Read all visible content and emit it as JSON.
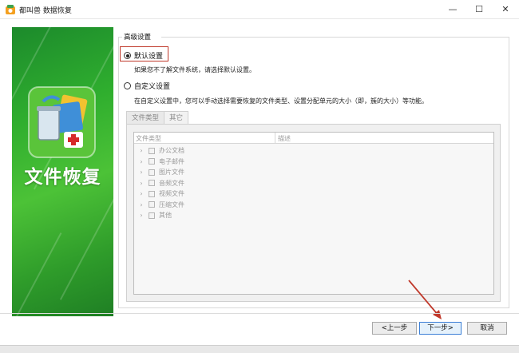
{
  "window": {
    "title": "都叫兽 数据恢复",
    "minimize_glyph": "—",
    "maximize_glyph": "☐",
    "close_glyph": "✕"
  },
  "sidebar": {
    "heading": "文件恢复",
    "icon": "recycle-bin-folder-rescue-icon"
  },
  "settings": {
    "group_label": "高级设置",
    "default_option": {
      "label": "默认设置",
      "selected": true,
      "hint": "如果您不了解文件系统，请选择默认设置。"
    },
    "custom_option": {
      "label": "自定义设置",
      "selected": false,
      "hint": "在自定义设置中，您可以手动选择需要恢复的文件类型、设置分配单元的大小（即，簇的大小）等功能。"
    }
  },
  "tabs": [
    {
      "label": "文件类型",
      "active": true
    },
    {
      "label": "其它",
      "active": false
    }
  ],
  "file_grid": {
    "columns": [
      "文件类型",
      "描述"
    ],
    "rows": [
      {
        "label": "办公文档",
        "checked": false
      },
      {
        "label": "电子邮件",
        "checked": false
      },
      {
        "label": "图片文件",
        "checked": false
      },
      {
        "label": "音频文件",
        "checked": false
      },
      {
        "label": "视频文件",
        "checked": false
      },
      {
        "label": "压缩文件",
        "checked": false
      },
      {
        "label": "其他",
        "checked": false
      }
    ]
  },
  "footer": {
    "prev_label": "<上一步",
    "next_label": "下一步>",
    "cancel_label": "取消"
  },
  "colors": {
    "sidebar_green": "#2fae2e",
    "highlight_red": "#c0392b",
    "primary_button_border": "#3c7fd6"
  }
}
